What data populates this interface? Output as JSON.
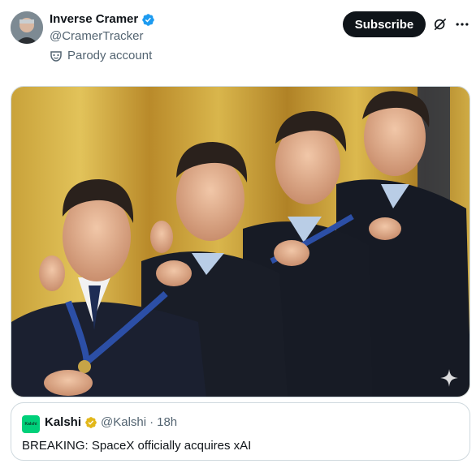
{
  "author": {
    "name": "Inverse Cramer",
    "handle": "@CramerTracker",
    "label": "Parody account"
  },
  "actions": {
    "subscribe_label": "Subscribe"
  },
  "icons": {
    "verified": "verified-badge-icon",
    "parody": "mask-icon",
    "grok": "grok-icon",
    "more": "more-options-icon",
    "sparkle": "sparkle-icon"
  },
  "quoted_post": {
    "logo_text": "Kalshi",
    "name": "Kalshi",
    "handle": "@Kalshi",
    "separator": "·",
    "time": "18h",
    "text": "BREAKING: SpaceX officially acquires xAI"
  },
  "colors": {
    "brand_blue": "#1d9bf0",
    "gold_badge": "#e2b719",
    "kalshi_green": "#00d07a",
    "text_secondary": "#536471"
  }
}
